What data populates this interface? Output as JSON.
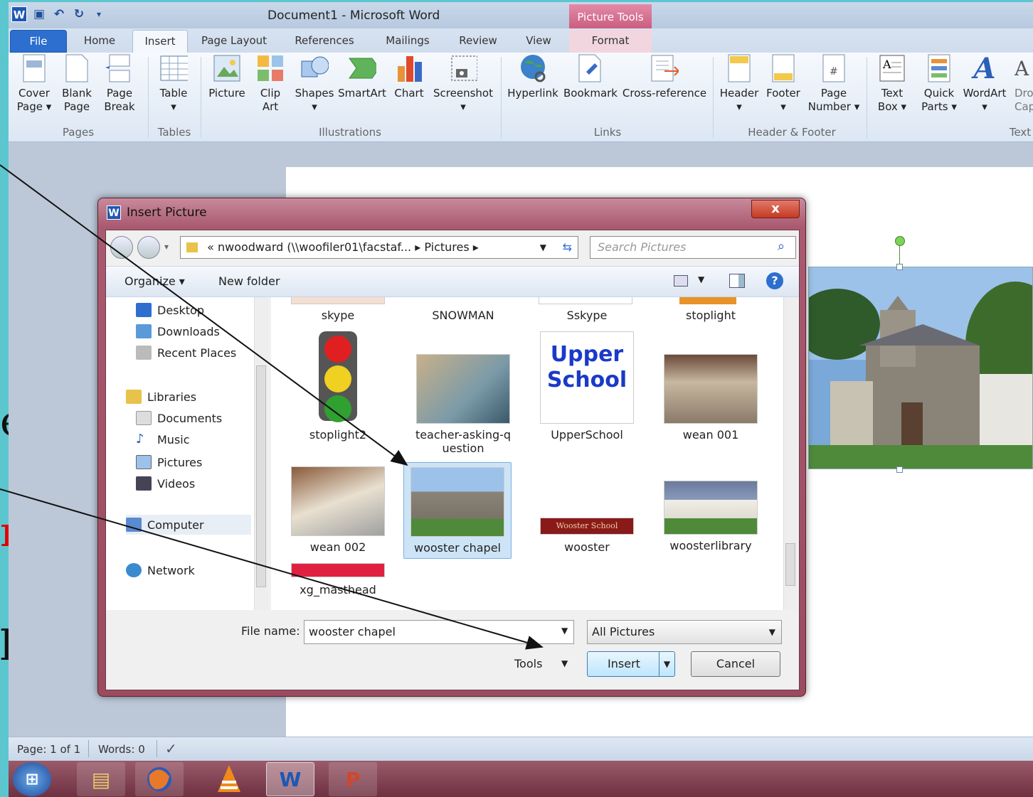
{
  "slide_fragments": [
    "e",
    "n",
    "l"
  ],
  "title_bar": {
    "document_title": "Document1  -  Microsoft Word",
    "contextual_group": "Picture Tools"
  },
  "tabs": [
    "File",
    "Home",
    "Insert",
    "Page Layout",
    "References",
    "Mailings",
    "Review",
    "View",
    "Format"
  ],
  "ribbon": {
    "buttons": [
      {
        "line1": "Cover",
        "line2": "Page ▾",
        "icon": "cover-page-icon"
      },
      {
        "line1": "Blank",
        "line2": "Page",
        "icon": "blank-page-icon"
      },
      {
        "line1": "Page",
        "line2": "Break",
        "icon": "page-break-icon"
      },
      {
        "line1": "Table",
        "line2": "▾",
        "icon": "table-icon"
      },
      {
        "line1": "Picture",
        "line2": "",
        "icon": "picture-icon"
      },
      {
        "line1": "Clip",
        "line2": "Art",
        "icon": "clip-art-icon"
      },
      {
        "line1": "Shapes",
        "line2": "▾",
        "icon": "shapes-icon"
      },
      {
        "line1": "SmartArt",
        "line2": "",
        "icon": "smartart-icon"
      },
      {
        "line1": "Chart",
        "line2": "",
        "icon": "chart-icon"
      },
      {
        "line1": "Screenshot",
        "line2": "▾",
        "icon": "screenshot-icon"
      },
      {
        "line1": "Hyperlink",
        "line2": "",
        "icon": "hyperlink-icon"
      },
      {
        "line1": "Bookmark",
        "line2": "",
        "icon": "bookmark-icon"
      },
      {
        "line1": "Cross-reference",
        "line2": "",
        "icon": "cross-reference-icon"
      },
      {
        "line1": "Header",
        "line2": "▾",
        "icon": "header-icon"
      },
      {
        "line1": "Footer",
        "line2": "▾",
        "icon": "footer-icon"
      },
      {
        "line1": "Page",
        "line2": "Number ▾",
        "icon": "page-number-icon"
      },
      {
        "line1": "Text",
        "line2": "Box ▾",
        "icon": "text-box-icon"
      },
      {
        "line1": "Quick",
        "line2": "Parts ▾",
        "icon": "quick-parts-icon"
      },
      {
        "line1": "WordArt",
        "line2": "▾",
        "icon": "wordart-icon"
      },
      {
        "line1": "Dro",
        "line2": "Cap",
        "icon": "drop-cap-icon"
      }
    ],
    "groups": [
      "Pages",
      "Tables",
      "Illustrations",
      "Links",
      "Header & Footer",
      "Text"
    ]
  },
  "dialog": {
    "title": "Insert Picture",
    "close": "x",
    "address": "«  nwoodward (\\\\woofiler01\\facstaf...  ▸  Pictures  ▸",
    "search_placeholder": "Search Pictures",
    "organize": "Organize ▾",
    "new_folder": "New folder",
    "nav_items": [
      "Desktop",
      "Downloads",
      "Recent Places",
      "Libraries",
      "Documents",
      "Music",
      "Pictures",
      "Videos",
      "Computer",
      "Network"
    ],
    "files": [
      "skype",
      "SNOWMAN",
      "Sskype",
      "stoplight",
      "stoplight2",
      "teacher-asking-question",
      "UpperSchool",
      "wean 001",
      "wean 002",
      "wooster chapel",
      "wooster",
      "woosterlibrary",
      "xg_masthead"
    ],
    "teacher_label_lines": [
      "teacher-asking-q",
      "uestion"
    ],
    "upper_school_text": [
      "Upper",
      "School"
    ],
    "wooster_banner_text": "Wooster School",
    "file_name_label": "File name:",
    "file_name_value": "wooster chapel",
    "file_type": "All Pictures",
    "tools": "Tools",
    "insert": "Insert",
    "cancel": "Cancel",
    "selected_file": "wooster chapel"
  },
  "status_bar": {
    "page": "Page: 1 of 1",
    "words": "Words: 0"
  },
  "taskbar": [
    "start-orb-icon",
    "explorer-icon",
    "firefox-icon",
    "vlc-icon",
    "word-icon",
    "powerpoint-icon"
  ],
  "colors": {
    "accent": "#2c6fce",
    "dialog_frame": "#a95a70",
    "slide_red": "#ff0000",
    "slide_strip": "#5cc6cf"
  }
}
